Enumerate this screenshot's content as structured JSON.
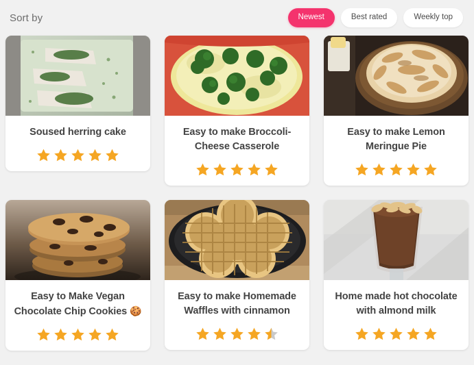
{
  "toolbar": {
    "sort_label": "Sort by",
    "buttons": [
      {
        "label": "Newest",
        "active": true
      },
      {
        "label": "Best rated",
        "active": false
      },
      {
        "label": "Weekly top",
        "active": false
      }
    ]
  },
  "colors": {
    "page_background": "#f1f1f1",
    "card_background": "#ffffff",
    "accent": "#f4336d",
    "star_filled": "#f5a623",
    "star_empty": "#c9c9c9",
    "title_text": "#434343",
    "label_text": "#6d6d6d"
  },
  "cards": [
    {
      "title": "Soused herring cake",
      "emoji": "",
      "rating": 5,
      "image_alt": "soused-herring-cake-photo"
    },
    {
      "title": "Easy to make Broccoli-Cheese Casserole",
      "emoji": "",
      "rating": 5,
      "image_alt": "broccoli-cheese-casserole-photo"
    },
    {
      "title": "Easy to make Lemon Meringue Pie",
      "emoji": "",
      "rating": 5,
      "image_alt": "lemon-meringue-pie-photo"
    },
    {
      "title": "Easy to Make Vegan Chocolate Chip Cookies",
      "emoji": "🍪",
      "rating": 5,
      "image_alt": "vegan-chocolate-chip-cookies-photo"
    },
    {
      "title": "Easy to make Homemade Waffles with cinnamon",
      "emoji": "",
      "rating": 4.5,
      "image_alt": "homemade-waffles-photo"
    },
    {
      "title": "Home made hot chocolate with almond milk",
      "emoji": "",
      "rating": 5,
      "image_alt": "hot-chocolate-almond-milk-photo"
    }
  ]
}
